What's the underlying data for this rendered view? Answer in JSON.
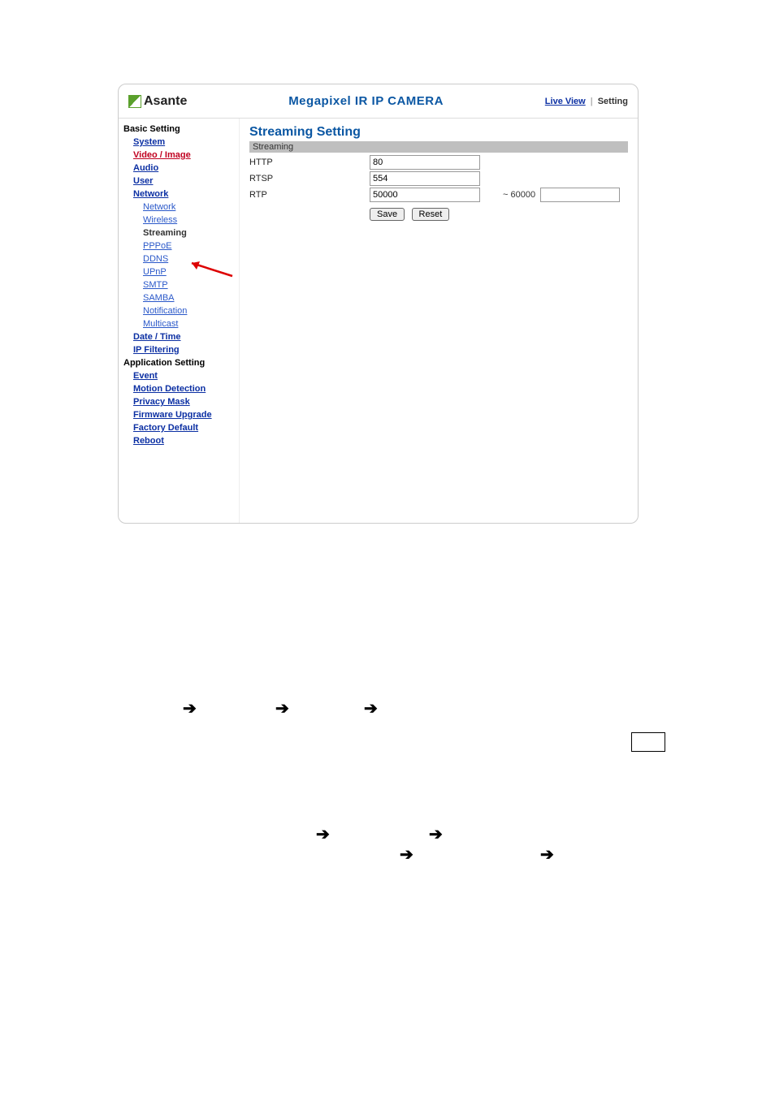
{
  "header": {
    "brand": "Asante",
    "title": "Megapixel IR IP CAMERA",
    "live_view": "Live View",
    "setting": "Setting"
  },
  "sidebar": {
    "basic_setting": "Basic Setting",
    "system": "System",
    "video_image": "Video / Image",
    "audio": "Audio",
    "user": "User",
    "network": "Network",
    "network_sub": "Network",
    "wireless": "Wireless",
    "streaming": "Streaming",
    "pppoe": "PPPoE",
    "ddns": "DDNS",
    "upnp": "UPnP",
    "smtp": "SMTP",
    "samba": "SAMBA",
    "notification": "Notification",
    "multicast": "Multicast",
    "date_time": "Date / Time",
    "ip_filtering": "IP Filtering",
    "application_setting": "Application Setting",
    "event": "Event",
    "motion_detection": "Motion Detection",
    "privacy_mask": "Privacy Mask",
    "firmware_upgrade": "Firmware Upgrade",
    "factory_default": "Factory Default",
    "reboot": "Reboot"
  },
  "panel": {
    "title": "Streaming Setting",
    "subheading": "Streaming",
    "http_label": "HTTP",
    "rtsp_label": "RTSP",
    "rtp_label": "RTP",
    "http_value": "80",
    "rtsp_value": "554",
    "rtp_from": "50000",
    "rtp_tilde": "~ 60000",
    "save": "Save",
    "reset": "Reset"
  },
  "arrows": {
    "a1": "➔",
    "a2": "➔",
    "a3": "➔",
    "a4": "➔",
    "a5": "➔",
    "a6": "➔",
    "a7": "➔"
  },
  "page_box": " "
}
